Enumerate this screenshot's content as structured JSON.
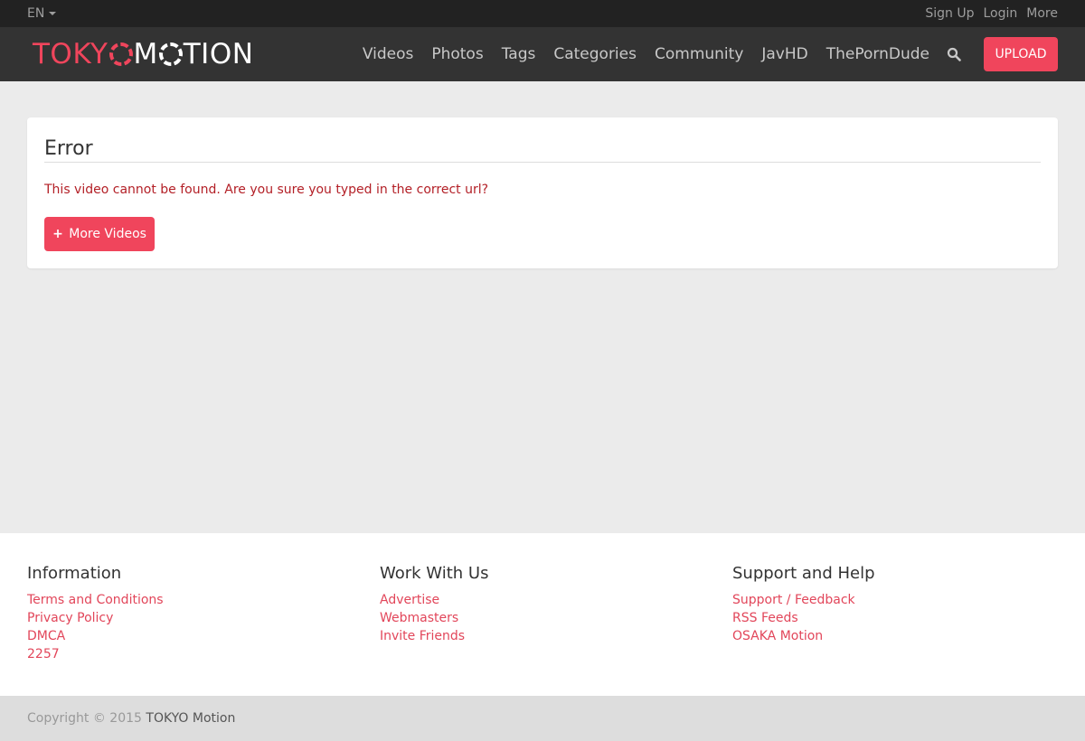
{
  "topbar": {
    "language": "EN",
    "links": [
      "Sign Up",
      "Login",
      "More"
    ]
  },
  "logo": {
    "part1": "TOKY",
    "part2": "M",
    "part3": "TION",
    "colors": {
      "accent": "#f0455c",
      "white": "#ffffff"
    }
  },
  "nav": {
    "items": [
      "Videos",
      "Photos",
      "Tags",
      "Categories",
      "Community",
      "JavHD",
      "ThePornDude"
    ],
    "search_icon": "search-icon",
    "upload_label": "UPLOAD"
  },
  "error": {
    "title": "Error",
    "message": "This video cannot be found. Are you sure you typed in the correct url?",
    "button_icon": "plus-icon",
    "button_label": "More Videos"
  },
  "footer": {
    "columns": [
      {
        "heading": "Information",
        "links": [
          "Terms and Conditions",
          "Privacy Policy",
          "DMCA",
          "2257"
        ]
      },
      {
        "heading": "Work With Us",
        "links": [
          "Advertise",
          "Webmasters",
          "Invite Friends"
        ]
      },
      {
        "heading": "Support and Help",
        "links": [
          "Support / Feedback",
          "RSS Feeds",
          "OSAKA Motion"
        ]
      }
    ],
    "copyright_prefix": "Copyright © 2015",
    "copyright_brand": "TOKYO Motion"
  },
  "colors": {
    "brand": "#f0455c",
    "topbar_bg": "#222222",
    "navbar_bg": "#333333",
    "page_bg": "#ebebeb",
    "error_text": "#b31f26"
  }
}
